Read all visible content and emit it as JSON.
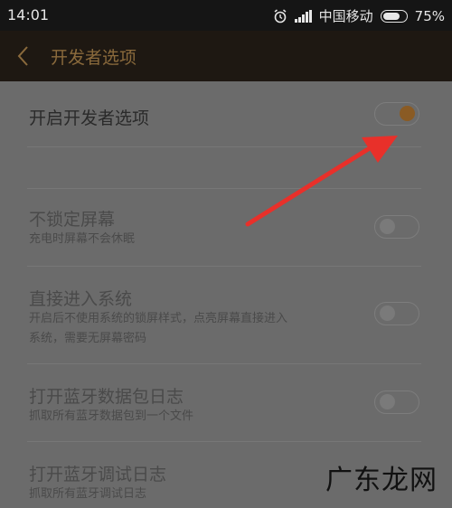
{
  "status_bar": {
    "time": "14:01",
    "carrier": "中国移动",
    "battery": "75%"
  },
  "header": {
    "title": "开发者选项"
  },
  "settings": [
    {
      "title": "开启开发者选项",
      "subtitle": "",
      "state": "on"
    },
    {
      "title": "不锁定屏幕",
      "subtitle": "充电时屏幕不会休眠",
      "state": "off"
    },
    {
      "title": "直接进入系统",
      "subtitle": "开启后不使用系统的锁屏样式，点亮屏幕直接进入",
      "subtitle2": "系统，需要无屏幕密码",
      "state": "off"
    },
    {
      "title": "打开蓝牙数据包日志",
      "subtitle": "抓取所有蓝牙数据包到一个文件",
      "state": "off"
    },
    {
      "title": "打开蓝牙调试日志",
      "subtitle": "抓取所有蓝牙调试日志"
    }
  ],
  "watermark": "广东龙网",
  "colors": {
    "accent": "#8a5b24",
    "arrow": "#e8302a"
  }
}
